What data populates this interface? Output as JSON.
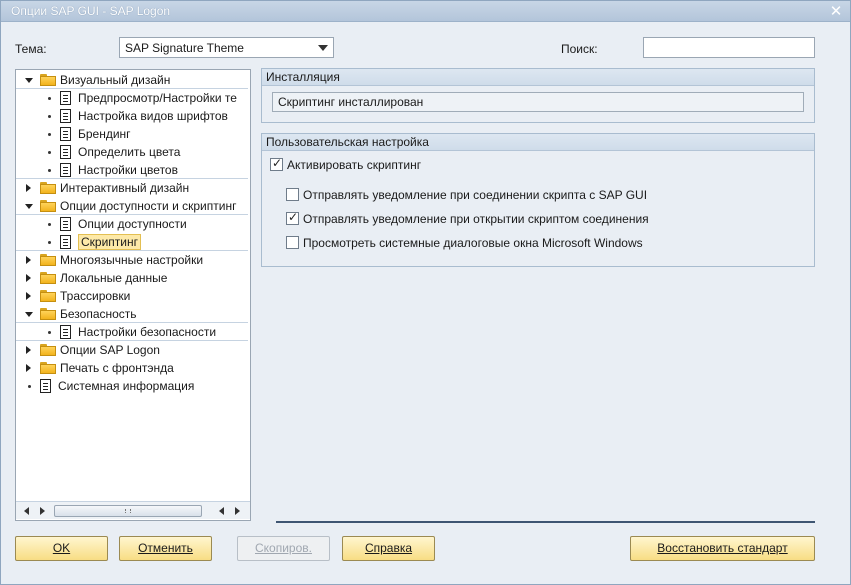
{
  "window": {
    "title": "Опции SAP GUI - SAP Logon",
    "close_glyph": "✕"
  },
  "theme": {
    "label": "Тема:",
    "value": "SAP Signature Theme"
  },
  "search": {
    "label": "Поиск:",
    "value": "",
    "placeholder": ""
  },
  "tree": {
    "items": [
      {
        "label": "Визуальный дизайн",
        "kind": "folder",
        "expander": "open",
        "level": 0
      },
      {
        "label": "Предпросмотр/Настройки те",
        "kind": "doc",
        "level": 1
      },
      {
        "label": "Настройка видов шрифтов",
        "kind": "doc",
        "level": 1
      },
      {
        "label": "Брендинг",
        "kind": "doc",
        "level": 1
      },
      {
        "label": "Определить цвета",
        "kind": "doc",
        "level": 1
      },
      {
        "label": "Настройки цветов",
        "kind": "doc",
        "level": 1
      },
      {
        "label": "Интерактивный дизайн",
        "kind": "folder",
        "expander": "closed",
        "level": 0
      },
      {
        "label": "Опции доступности и скриптинг",
        "kind": "folder",
        "expander": "open",
        "level": 0
      },
      {
        "label": "Опции доступности",
        "kind": "doc",
        "level": 1
      },
      {
        "label": "Скриптинг",
        "kind": "doc",
        "level": 1,
        "selected": true
      },
      {
        "label": "Многоязычные настройки",
        "kind": "folder",
        "expander": "closed",
        "level": 0
      },
      {
        "label": "Локальные данные",
        "kind": "folder",
        "expander": "closed",
        "level": 0
      },
      {
        "label": "Трассировки",
        "kind": "folder",
        "expander": "closed",
        "level": 0
      },
      {
        "label": "Безопасность",
        "kind": "folder",
        "expander": "open",
        "level": 0
      },
      {
        "label": "Настройки безопасности",
        "kind": "doc",
        "level": 1
      },
      {
        "label": "Опции SAP Logon",
        "kind": "folder",
        "expander": "closed",
        "level": 0
      },
      {
        "label": "Печать с фронтэнда",
        "kind": "folder",
        "expander": "closed",
        "level": 0
      },
      {
        "label": "Системная информация",
        "kind": "doc",
        "level": 0
      }
    ],
    "scroll_grip": "⁞"
  },
  "installation": {
    "header": "Инсталляция",
    "status": "Скриптинг инсталлирован"
  },
  "user_settings": {
    "header": "Пользовательская настройка",
    "checkboxes": [
      {
        "label": "Активировать скриптинг",
        "checked": true
      },
      {
        "label": "Отправлять уведомление при соединении скрипта с SAP GUI",
        "checked": false
      },
      {
        "label": "Отправлять уведомление при открытии скриптом соединения",
        "checked": true
      },
      {
        "label": "Просмотреть системные диалоговые окна Microsoft Windows",
        "checked": false
      }
    ]
  },
  "buttons": {
    "ok": "OK",
    "cancel": "Отменить",
    "copy": "Скопиров.",
    "help": "Справка",
    "restore": "Восстановить стандарт"
  },
  "colors": {
    "title_bar": "#b3c5da",
    "button_face": "#f8dd84",
    "selection": "#fde9a8",
    "separator": "#3e5572"
  },
  "icons": {
    "folder": "folder-icon",
    "document": "document-icon",
    "expander_open": "triangle-down-icon",
    "expander_closed": "triangle-right-icon",
    "close": "close-icon"
  }
}
